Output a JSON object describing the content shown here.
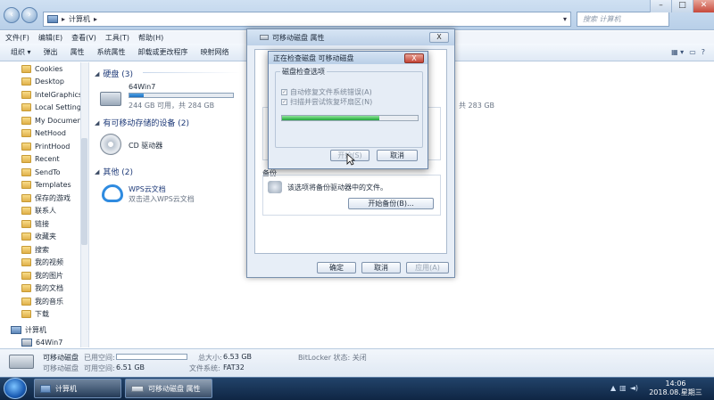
{
  "explorer": {
    "address": [
      "计算机"
    ],
    "search_placeholder": "搜索 计算机",
    "menu": [
      "文件(F)",
      "编辑(E)",
      "查看(V)",
      "工具(T)",
      "帮助(H)"
    ],
    "toolbar": [
      "组织 ▾",
      "弹出",
      "属性",
      "系统属性",
      "卸载或更改程序",
      "映射网络"
    ],
    "sidebar": [
      "Cookies",
      "Desktop",
      "IntelGraphicsP",
      "Local Settings",
      "My Document",
      "NetHood",
      "PrintHood",
      "Recent",
      "SendTo",
      "Templates",
      "保存的游戏",
      "联系人",
      "链接",
      "收藏夹",
      "搜索",
      "我的视频",
      "我的图片",
      "我的文档",
      "我的音乐",
      "下载"
    ],
    "sidebar_computer": "计算机",
    "sidebar_drive": "64Win7",
    "groups": {
      "hdd": "硬盘 (3)",
      "removable": "有可移动存储的设备 (2)",
      "other": "其他 (2)"
    },
    "drive": {
      "name": "64Win7",
      "free": "244 GB 可用，共 284 GB",
      "used_fraction": 0.14
    },
    "drive_right": "共 283 GB",
    "cd": "CD 驱动器",
    "wps": {
      "name": "WPS云文档",
      "desc": "双击进入WPS云文档"
    }
  },
  "status": {
    "name": "可移动磁盘",
    "type": "可移动磁盘",
    "used_label": "已用空间:",
    "free_label": "可用空间:",
    "free": "6.51 GB",
    "total_label": "总大小:",
    "total": "6.53 GB",
    "fs_label": "文件系统:",
    "fs": "FAT32",
    "bitlocker": "BitLocker 状态: 关闭"
  },
  "taskbar": {
    "items": [
      "计算机",
      "可移动磁盘 属性"
    ],
    "time": "14:06",
    "date": "2018.08.星期三"
  },
  "properties": {
    "title": "可移动磁盘 属性",
    "close": "X",
    "backup_label": "备份",
    "backup_text": "该选项将备份驱动器中的文件。",
    "backup_btn": "开始备份(B)...",
    "ok": "确定",
    "cancel": "取消",
    "apply": "应用(A)"
  },
  "check": {
    "title": "正在检查磁盘 可移动磁盘",
    "close": "X",
    "group": "磁盘检查选项",
    "opt1": "自动修复文件系统错误(A)",
    "opt2": "扫描并尝试恢复坏扇区(N)",
    "progress": 0.72,
    "start": "开始(S)",
    "cancel": "取消"
  }
}
